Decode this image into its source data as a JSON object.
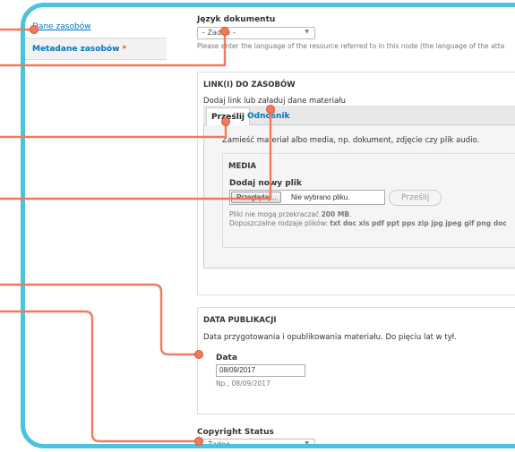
{
  "sidebar": {
    "items": [
      {
        "label": "Dane zasobów"
      },
      {
        "label": "Metadane zasobów",
        "required_mark": "*"
      }
    ]
  },
  "language": {
    "label": "Język dokumentu",
    "value": "– Żadne –",
    "description": "Please enter the language of the resource referred to in this node (the language of the atta"
  },
  "links": {
    "legend": "LINK(I) DO ZASOBÓW",
    "intro": "Dodaj link lub załaduj dane materiału",
    "tabs": [
      {
        "label": "Prześlij"
      },
      {
        "label": "Odnośnik"
      }
    ],
    "pane_text": "Zamieść materiał albo media, np. dokument, zdjęcie czy plik audio.",
    "media": {
      "legend": "MEDIA",
      "add_label": "Dodaj nowy plik",
      "browse_label": "Przeglądaj...",
      "no_file": "Nie wybrano pliku.",
      "upload_label": "Prześlij",
      "limit_prefix": "Pliki nie mogą przekraczać",
      "limit_value": "200 MB",
      "types_prefix": "Dopuszczalne rodzaje plików:",
      "types_value": "txt doc xls pdf ppt pps zip jpg jpeg gif png doc"
    }
  },
  "publication": {
    "legend": "DATA PUBLIKACJI",
    "intro": "Data przygotowania i opublikowania materiału. Do pięciu lat w tył.",
    "date_label": "Data",
    "date_value": "08/09/2017",
    "example": "Np., 08/09/2017"
  },
  "copyright": {
    "label": "Copyright Status",
    "value": "– Żadne –"
  },
  "colors": {
    "frame": "#4cc3dd",
    "annotation": "#f07a5b",
    "link": "#0074bd"
  }
}
